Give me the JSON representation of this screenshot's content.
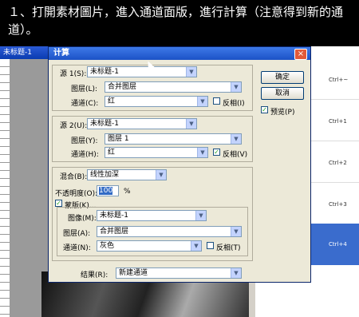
{
  "caption": "１、打開素材圖片，進入通道面版，進行計算（注意得到新的通道）。",
  "background_window": {
    "title": "未标题-1"
  },
  "channels_panel": {
    "shortcuts": [
      "Ctrl+~",
      "Ctrl+1",
      "Ctrl+2",
      "Ctrl+3",
      "Ctrl+4"
    ],
    "selected_index_label": "1"
  },
  "dialog": {
    "title": "计算",
    "ok_label": "确定",
    "cancel_label": "取消",
    "preview_label": "预览(P)",
    "source1": {
      "label": "源 1(S):",
      "value": "未标题-1",
      "layer_label": "图层(L):",
      "layer_value": "合并图层",
      "channel_label": "通道(C):",
      "channel_value": "红",
      "invert_label": "反相(I)",
      "invert_checked": false
    },
    "source2": {
      "label": "源 2(U):",
      "value": "未标题-1",
      "layer_label": "图层(Y):",
      "layer_value": "图层 1",
      "channel_label": "通道(H):",
      "channel_value": "红",
      "invert_label": "反相(V)",
      "invert_checked": true
    },
    "blending": {
      "label": "混合(B):",
      "value": "线性加深",
      "opacity_label": "不透明度(O):",
      "opacity_value": "100",
      "opacity_unit": "%",
      "mask_label": "蒙版(K)...",
      "mask_checked": true,
      "image_label": "图像(M):",
      "image_value": "未标题-1",
      "layer_label": "图层(A):",
      "layer_value": "合并图层",
      "channel_label": "通道(N):",
      "channel_value": "灰色",
      "invert_label": "反相(T)",
      "invert_checked": false
    },
    "result": {
      "label": "结果(R):",
      "value": "新建通道"
    }
  }
}
